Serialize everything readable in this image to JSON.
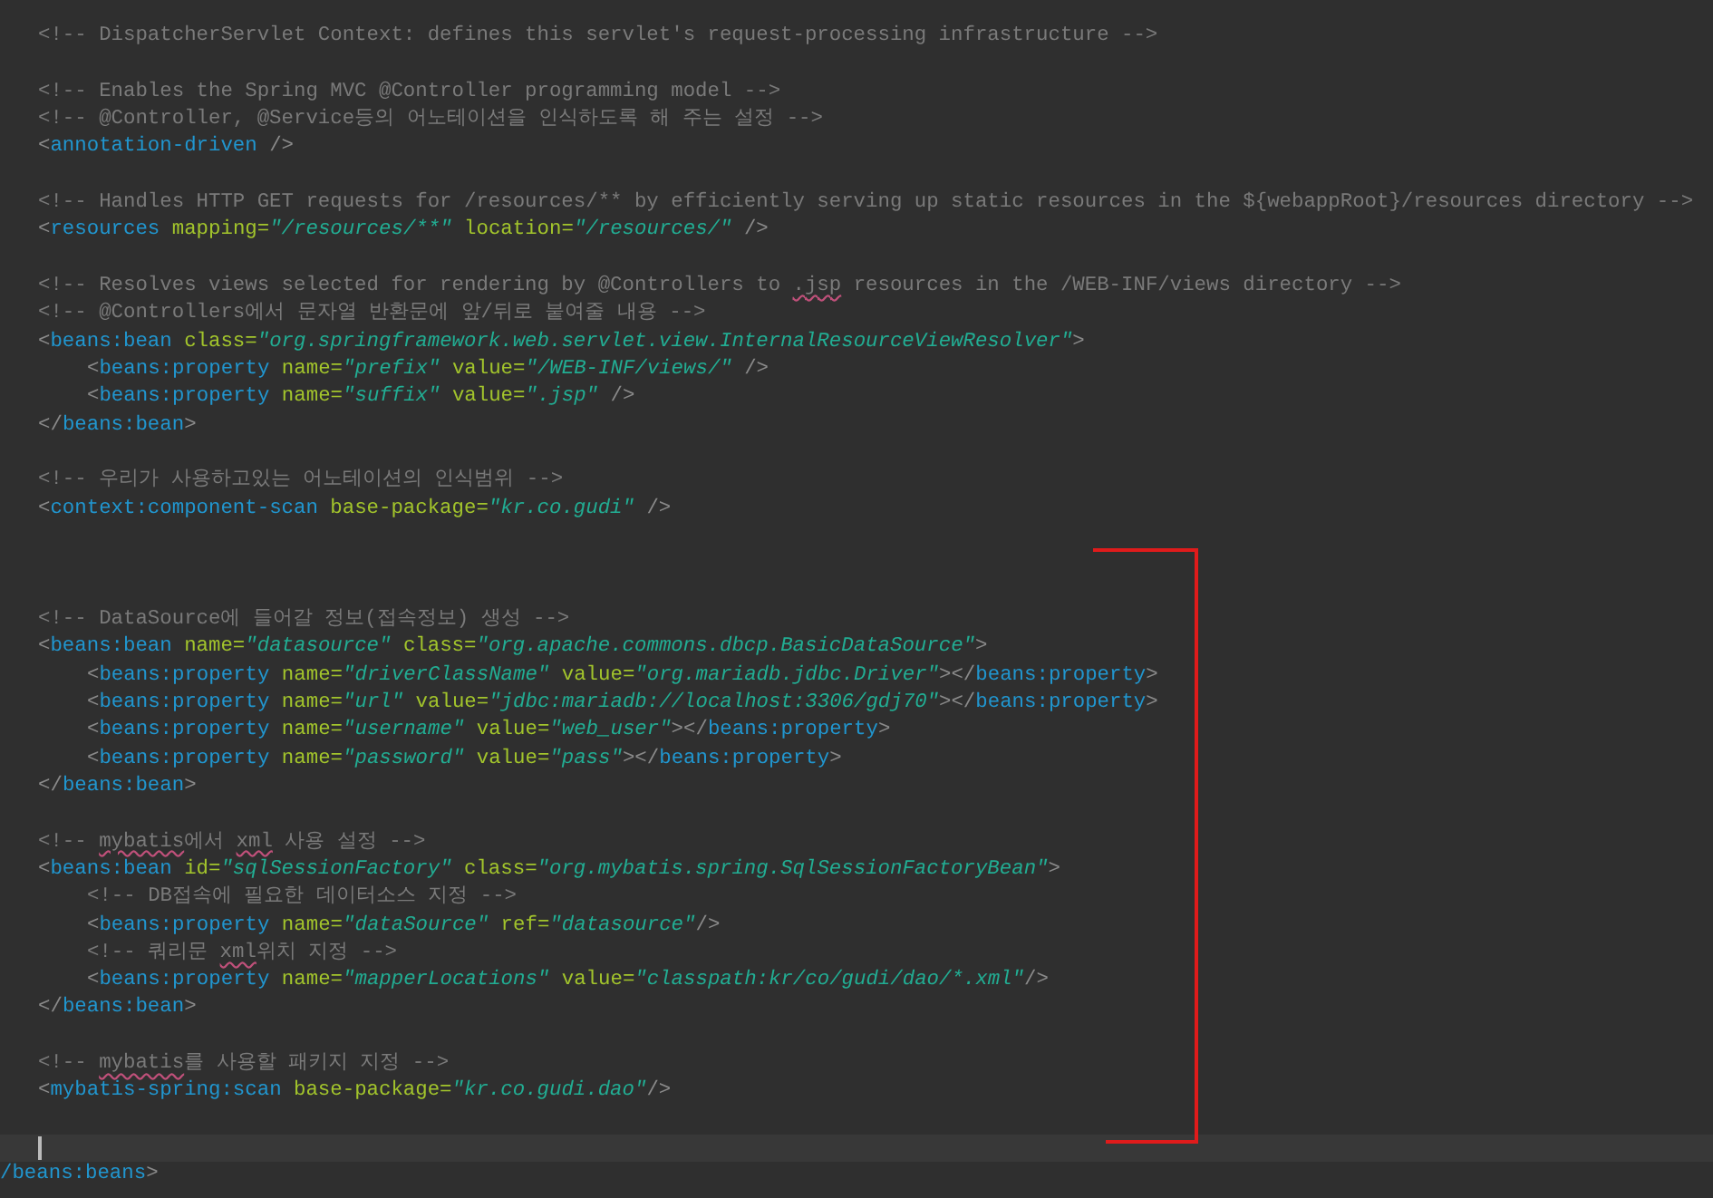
{
  "editor": {
    "lines": [
      {
        "kind": "top",
        "current": false,
        "tokens": [
          {
            "kind": "comment",
            "text": "<!-- DispatcherServlet Context: defines this servlet's request-processing infrastructure -->"
          }
        ]
      },
      {
        "kind": "top",
        "current": false
      },
      {
        "kind": "top",
        "current": false,
        "tokens": [
          {
            "kind": "comment",
            "text": "<!-- Enables the Spring MVC @Controller programming model -->"
          }
        ]
      },
      {
        "kind": "top",
        "current": false,
        "tokens": [
          {
            "kind": "comment",
            "text": "<!-- @Controller, @Service등의 어노테이션을 인식하도록 해 주는 설정 -->"
          }
        ]
      },
      {
        "kind": "top",
        "current": false,
        "tokens": [
          {
            "kind": "punct",
            "text": "<"
          },
          {
            "kind": "tag",
            "text": "annotation-driven"
          },
          {
            "kind": "punct",
            "text": " />"
          }
        ]
      },
      {
        "kind": "top",
        "current": false
      },
      {
        "kind": "top",
        "current": false,
        "tokens": [
          {
            "kind": "comment",
            "text": "<!-- Handles HTTP GET requests for /resources/** by efficiently serving up static resources in the ${webappRoot}/resources directory -->"
          }
        ]
      },
      {
        "kind": "top",
        "current": false,
        "tokens": [
          {
            "kind": "punct",
            "text": "<"
          },
          {
            "kind": "tag",
            "text": "resources"
          },
          {
            "kind": "attr",
            "text": " mapping="
          },
          {
            "kind": "value",
            "text": "\"/resources/**\""
          },
          {
            "kind": "attr",
            "text": " location="
          },
          {
            "kind": "value",
            "text": "\"/resources/\""
          },
          {
            "kind": "punct",
            "text": " />"
          }
        ]
      },
      {
        "kind": "top",
        "current": false
      },
      {
        "kind": "top",
        "current": false,
        "tokens": [
          {
            "kind": "comment",
            "text": "<!-- Resolves views selected for rendering by @Controllers to "
          },
          {
            "kind": "flagged",
            "text": ".jsp"
          },
          {
            "kind": "comment",
            "text": " resources in the /WEB-INF/views directory -->"
          }
        ]
      },
      {
        "kind": "top",
        "current": false,
        "tokens": [
          {
            "kind": "comment",
            "text": "<!-- @Controllers에서 문자열 반환문에 앞/뒤로 붙여줄 내용 -->"
          }
        ]
      },
      {
        "kind": "top",
        "current": false,
        "tokens": [
          {
            "kind": "punct",
            "text": "<"
          },
          {
            "kind": "tag",
            "text": "beans:bean"
          },
          {
            "kind": "attr",
            "text": " class="
          },
          {
            "kind": "value",
            "text": "\"org.springframework.web.servlet.view.InternalResourceViewResolver\""
          },
          {
            "kind": "punct",
            "text": ">"
          }
        ]
      },
      {
        "kind": "nested",
        "current": false,
        "tokens": [
          {
            "kind": "punct",
            "text": "<"
          },
          {
            "kind": "tag",
            "text": "beans:property"
          },
          {
            "kind": "attr",
            "text": " name="
          },
          {
            "kind": "value",
            "text": "\"prefix\""
          },
          {
            "kind": "attr",
            "text": " value="
          },
          {
            "kind": "value",
            "text": "\"/WEB-INF/views/\""
          },
          {
            "kind": "punct",
            "text": " />"
          }
        ]
      },
      {
        "kind": "nested",
        "current": false,
        "tokens": [
          {
            "kind": "punct",
            "text": "<"
          },
          {
            "kind": "tag",
            "text": "beans:property"
          },
          {
            "kind": "attr",
            "text": " name="
          },
          {
            "kind": "value",
            "text": "\"suffix\""
          },
          {
            "kind": "attr",
            "text": " value="
          },
          {
            "kind": "value",
            "text": "\".jsp\""
          },
          {
            "kind": "punct",
            "text": " />"
          }
        ]
      },
      {
        "kind": "top",
        "current": false,
        "tokens": [
          {
            "kind": "punct",
            "text": "</"
          },
          {
            "kind": "tag",
            "text": "beans:bean"
          },
          {
            "kind": "punct",
            "text": ">"
          }
        ]
      },
      {
        "kind": "top",
        "current": false
      },
      {
        "kind": "top",
        "current": false,
        "tokens": [
          {
            "kind": "comment",
            "text": "<!-- 우리가 사용하고있는 어노테이션의 인식범위 -->"
          }
        ]
      },
      {
        "kind": "top",
        "current": false,
        "tokens": [
          {
            "kind": "punct",
            "text": "<"
          },
          {
            "kind": "tag",
            "text": "context:component-scan"
          },
          {
            "kind": "attr",
            "text": " base-package="
          },
          {
            "kind": "value",
            "text": "\"kr.co.gudi\""
          },
          {
            "kind": "punct",
            "text": " />"
          }
        ]
      },
      {
        "kind": "top",
        "current": false
      },
      {
        "kind": "top",
        "current": false
      },
      {
        "kind": "top",
        "current": false
      },
      {
        "kind": "top",
        "current": false,
        "tokens": [
          {
            "kind": "comment",
            "text": "<!-- DataSource에 들어갈 정보(접속정보) 생성 -->"
          }
        ]
      },
      {
        "kind": "top",
        "current": false,
        "tokens": [
          {
            "kind": "punct",
            "text": "<"
          },
          {
            "kind": "tag",
            "text": "beans:bean"
          },
          {
            "kind": "attr",
            "text": " name="
          },
          {
            "kind": "value",
            "text": "\"datasource\""
          },
          {
            "kind": "attr",
            "text": " class="
          },
          {
            "kind": "value",
            "text": "\"org.apache.commons.dbcp.BasicDataSource\""
          },
          {
            "kind": "punct",
            "text": ">"
          }
        ]
      },
      {
        "kind": "nested",
        "current": false,
        "tokens": [
          {
            "kind": "punct",
            "text": "<"
          },
          {
            "kind": "tag",
            "text": "beans:property"
          },
          {
            "kind": "attr",
            "text": " name="
          },
          {
            "kind": "value",
            "text": "\"driverClassName\""
          },
          {
            "kind": "attr",
            "text": " value="
          },
          {
            "kind": "value",
            "text": "\"org.mariadb.jdbc.Driver\""
          },
          {
            "kind": "punct",
            "text": "></"
          },
          {
            "kind": "tag",
            "text": "beans:property"
          },
          {
            "kind": "punct",
            "text": ">"
          }
        ]
      },
      {
        "kind": "nested",
        "current": false,
        "tokens": [
          {
            "kind": "punct",
            "text": "<"
          },
          {
            "kind": "tag",
            "text": "beans:property"
          },
          {
            "kind": "attr",
            "text": " name="
          },
          {
            "kind": "value",
            "text": "\"url\""
          },
          {
            "kind": "attr",
            "text": " value="
          },
          {
            "kind": "value",
            "text": "\"jdbc:mariadb://localhost:3306/gdj70\""
          },
          {
            "kind": "punct",
            "text": "></"
          },
          {
            "kind": "tag",
            "text": "beans:property"
          },
          {
            "kind": "punct",
            "text": ">"
          }
        ]
      },
      {
        "kind": "nested",
        "current": false,
        "tokens": [
          {
            "kind": "punct",
            "text": "<"
          },
          {
            "kind": "tag",
            "text": "beans:property"
          },
          {
            "kind": "attr",
            "text": " name="
          },
          {
            "kind": "value",
            "text": "\"username\""
          },
          {
            "kind": "attr",
            "text": " value="
          },
          {
            "kind": "value",
            "text": "\"web_user\""
          },
          {
            "kind": "punct",
            "text": "></"
          },
          {
            "kind": "tag",
            "text": "beans:property"
          },
          {
            "kind": "punct",
            "text": ">"
          }
        ]
      },
      {
        "kind": "nested",
        "current": false,
        "tokens": [
          {
            "kind": "punct",
            "text": "<"
          },
          {
            "kind": "tag",
            "text": "beans:property"
          },
          {
            "kind": "attr",
            "text": " name="
          },
          {
            "kind": "value",
            "text": "\"password\""
          },
          {
            "kind": "attr",
            "text": " value="
          },
          {
            "kind": "value",
            "text": "\"pass\""
          },
          {
            "kind": "punct",
            "text": "></"
          },
          {
            "kind": "tag",
            "text": "beans:property"
          },
          {
            "kind": "punct",
            "text": ">"
          }
        ]
      },
      {
        "kind": "top",
        "current": false,
        "tokens": [
          {
            "kind": "punct",
            "text": "</"
          },
          {
            "kind": "tag",
            "text": "beans:bean"
          },
          {
            "kind": "punct",
            "text": ">"
          }
        ]
      },
      {
        "kind": "top",
        "current": false
      },
      {
        "kind": "top",
        "current": false,
        "tokens": [
          {
            "kind": "comment",
            "text": "<!-- "
          },
          {
            "kind": "flagged",
            "text": "mybatis"
          },
          {
            "kind": "comment",
            "text": "에서 "
          },
          {
            "kind": "flagged",
            "text": "xml"
          },
          {
            "kind": "comment",
            "text": " 사용 설정 -->"
          }
        ]
      },
      {
        "kind": "top",
        "current": false,
        "tokens": [
          {
            "kind": "punct",
            "text": "<"
          },
          {
            "kind": "tag",
            "text": "beans:bean"
          },
          {
            "kind": "attr",
            "text": " id="
          },
          {
            "kind": "value",
            "text": "\"sqlSessionFactory\""
          },
          {
            "kind": "attr",
            "text": " class="
          },
          {
            "kind": "value",
            "text": "\"org.mybatis.spring.SqlSessionFactoryBean\""
          },
          {
            "kind": "punct",
            "text": ">"
          }
        ]
      },
      {
        "kind": "nested",
        "current": false,
        "tokens": [
          {
            "kind": "comment",
            "text": "<!-- DB접속에 필요한 데이터소스 지정 -->"
          }
        ]
      },
      {
        "kind": "nested",
        "current": false,
        "tokens": [
          {
            "kind": "punct",
            "text": "<"
          },
          {
            "kind": "tag",
            "text": "beans:property"
          },
          {
            "kind": "attr",
            "text": " name="
          },
          {
            "kind": "value",
            "text": "\"dataSource\""
          },
          {
            "kind": "attr",
            "text": " ref="
          },
          {
            "kind": "value",
            "text": "\"datasource\""
          },
          {
            "kind": "punct",
            "text": "/>"
          }
        ]
      },
      {
        "kind": "nested",
        "current": false,
        "tokens": [
          {
            "kind": "comment",
            "text": "<!-- 쿼리문 "
          },
          {
            "kind": "flagged",
            "text": "xml"
          },
          {
            "kind": "comment",
            "text": "위치 지정 -->"
          }
        ]
      },
      {
        "kind": "nested",
        "current": false,
        "tokens": [
          {
            "kind": "punct",
            "text": "<"
          },
          {
            "kind": "tag",
            "text": "beans:property"
          },
          {
            "kind": "attr",
            "text": " name="
          },
          {
            "kind": "value",
            "text": "\"mapperLocations\""
          },
          {
            "kind": "attr",
            "text": " value="
          },
          {
            "kind": "value",
            "text": "\"classpath:kr/co/gudi/dao/*.xml\""
          },
          {
            "kind": "punct",
            "text": "/>"
          }
        ]
      },
      {
        "kind": "top",
        "current": false,
        "tokens": [
          {
            "kind": "punct",
            "text": "</"
          },
          {
            "kind": "tag",
            "text": "beans:bean"
          },
          {
            "kind": "punct",
            "text": ">"
          }
        ]
      },
      {
        "kind": "top",
        "current": false
      },
      {
        "kind": "top",
        "current": false,
        "tokens": [
          {
            "kind": "comment",
            "text": "<!-- "
          },
          {
            "kind": "flagged",
            "text": "mybatis"
          },
          {
            "kind": "comment",
            "text": "를 사용할 패키지 지정 -->"
          }
        ]
      },
      {
        "kind": "top",
        "current": false,
        "tokens": [
          {
            "kind": "punct",
            "text": "<"
          },
          {
            "kind": "tag",
            "text": "mybatis-spring:scan"
          },
          {
            "kind": "attr",
            "text": " base-package="
          },
          {
            "kind": "value",
            "text": "\"kr.co.gudi.dao\""
          },
          {
            "kind": "punct",
            "text": "/>"
          }
        ]
      },
      {
        "kind": "top",
        "current": false
      },
      {
        "kind": "top",
        "current": true
      },
      {
        "kind": "cut",
        "current": false,
        "tokens": [
          {
            "kind": "tag",
            "text": "/beans:beans"
          },
          {
            "kind": "punct",
            "text": ">"
          }
        ]
      }
    ]
  }
}
